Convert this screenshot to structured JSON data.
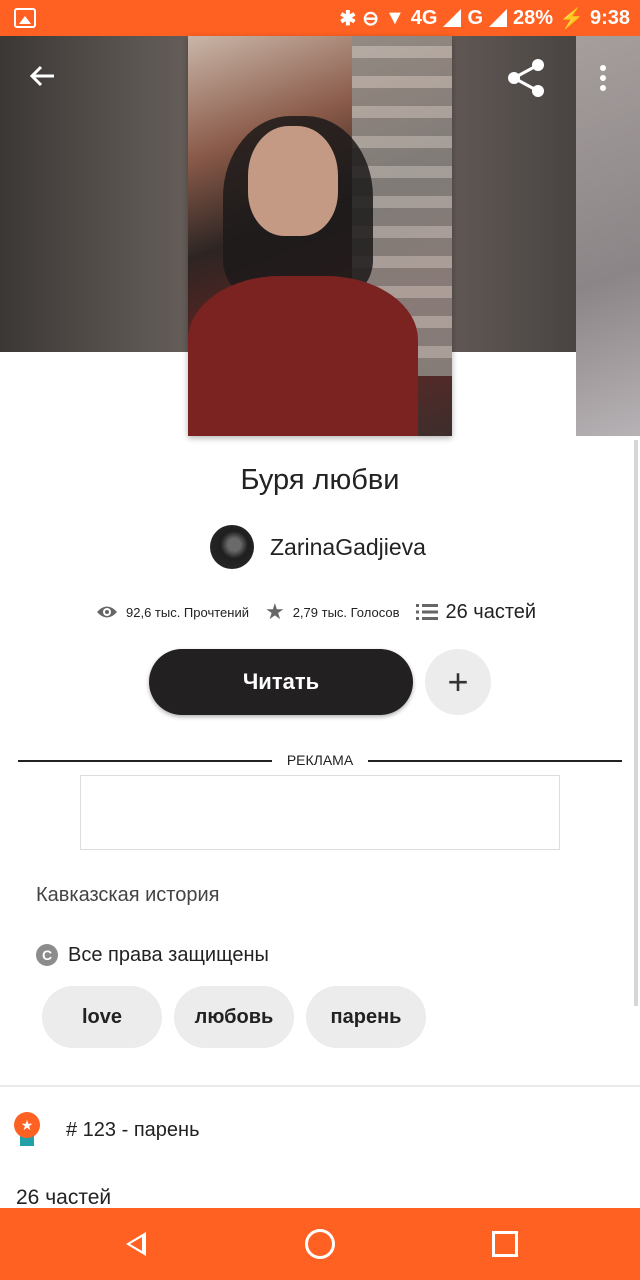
{
  "status_bar": {
    "network": "4G",
    "network2": "G",
    "battery": "28%",
    "time": "9:38"
  },
  "header": {
    "back_icon": "arrow-back-icon",
    "share_icon": "share-icon",
    "menu_icon": "more-vert-icon"
  },
  "story": {
    "title": "Буря любви",
    "author": "ZarinaGadjieva",
    "reads": "92,6 тыс. Прочтений",
    "votes": "2,79 тыс. Голосов",
    "parts": "26 частей"
  },
  "actions": {
    "read_label": "Читать",
    "add_label": "+"
  },
  "ad": {
    "label": "РЕКЛАМА"
  },
  "description": "Кавказская история",
  "copyright": {
    "icon_letter": "C",
    "text": "Все права защищены"
  },
  "tags": [
    "love",
    "любовь",
    "парень"
  ],
  "ranking": {
    "text": "# 123 - парень",
    "icon_glyph": "★"
  },
  "parts_section": "26 частей",
  "colors": {
    "accent": "#ff6122",
    "button_dark": "#222021",
    "chip_bg": "#ececec",
    "ribbon": "#21a0a8"
  }
}
